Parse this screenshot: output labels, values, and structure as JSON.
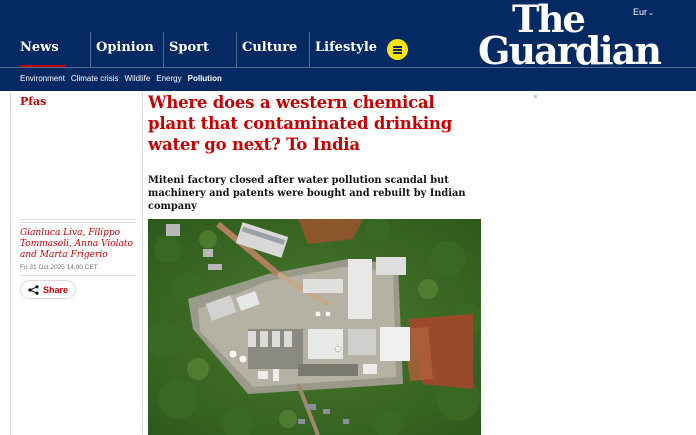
{
  "header": {
    "edition": "Eur",
    "logo_line1": "The",
    "logo_line2": "Guardian",
    "pillars": [
      "News",
      "Opinion",
      "Sport",
      "Culture",
      "Lifestyle"
    ],
    "active_pillar": "News",
    "subnav": [
      "Environment",
      "Climate crisis",
      "Wildlife",
      "Energy",
      "Pollution"
    ],
    "active_subnav": "Pollution"
  },
  "article": {
    "kicker": "Pfas",
    "headline": "Where does a western chemical plant that contaminated drinking water go next? To India",
    "standfirst": "Miteni factory closed after water pollution scandal but machinery and patents were bought and rebuilt by Indian company",
    "byline": "Gianluca Liva, Filippo Tommasoli, Anna Violato and Marta Frigerio",
    "dateline": "Fri 31 Oct 2025 14.00 CET",
    "share_label": "Share"
  },
  "colors": {
    "brand_navy": "#052962",
    "news_red": "#c70000",
    "menu_yellow": "#ffe500"
  },
  "icons": {
    "share": "share-icon",
    "menu": "hamburger-menu-icon",
    "edition_chevron": "chevron-down-icon"
  }
}
